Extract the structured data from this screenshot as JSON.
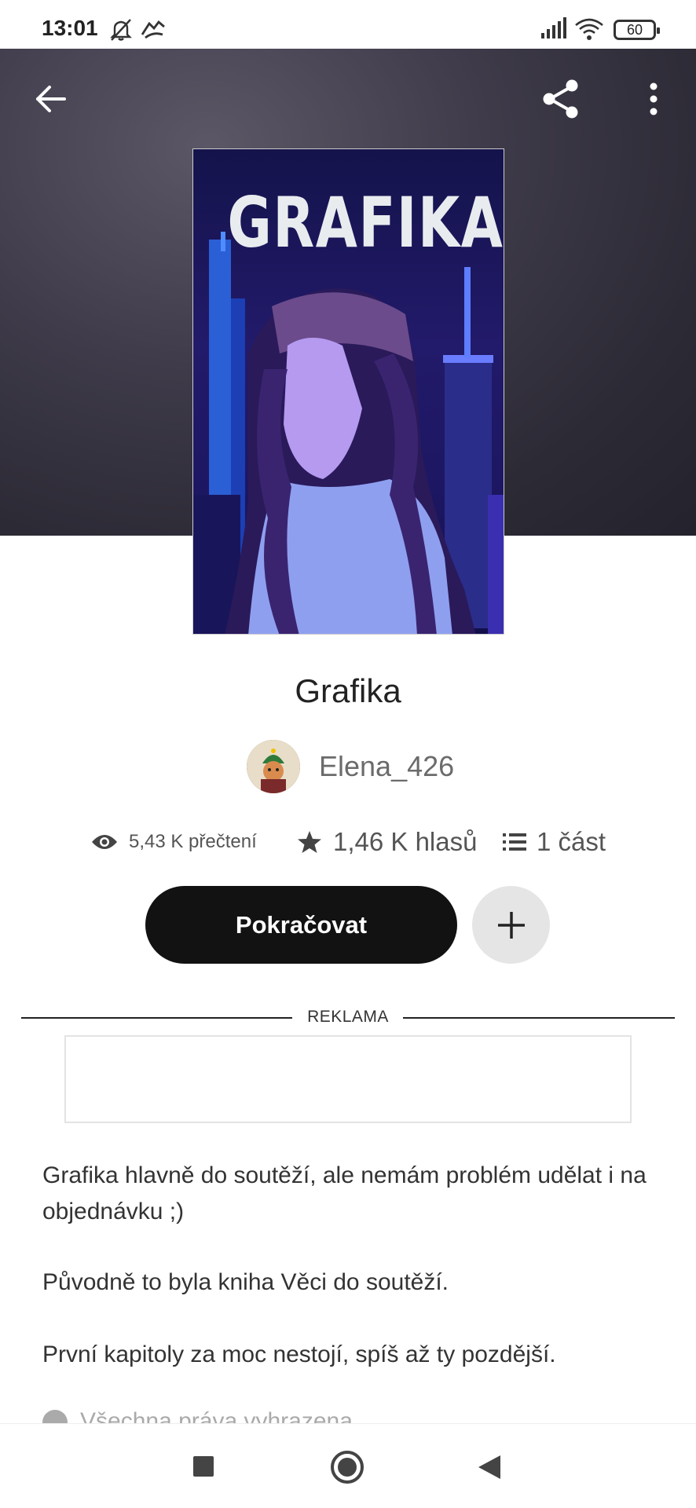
{
  "status_bar": {
    "time": "13:01",
    "battery": "60",
    "icons": [
      "bell-off-icon",
      "data-saver-icon",
      "signal-icon",
      "wifi-icon",
      "battery-icon"
    ]
  },
  "header": {
    "back_icon": "arrow-left-icon",
    "share_icon": "share-icon",
    "more_icon": "more-vertical-icon"
  },
  "cover": {
    "title_text": "GRAFIKA"
  },
  "book": {
    "title": "Grafika",
    "author": "Elena_426"
  },
  "stats": {
    "reads": "5,43 K přečtení",
    "votes": "1,46 K hlasů",
    "parts": "1 část"
  },
  "actions": {
    "continue_label": "Pokračovat",
    "add_icon": "plus-icon"
  },
  "ad": {
    "label": "REKLAMA"
  },
  "description": {
    "paragraphs": [
      "Grafika hlavně do soutěží, ale nemám problém udělat i na objednávku ;)",
      "Původně to byla kniha Věci do soutěží.",
      "První kapitoly za moc nestojí, spíš až ty pozdější."
    ],
    "rights": "Všechna práva vyhrazena"
  },
  "nav": {
    "icons": [
      "recents-icon",
      "home-icon",
      "back-icon"
    ]
  },
  "colors": {
    "button_dark": "#121212",
    "add_button_bg": "#e5e5e5",
    "header_bg": "#2c2a35"
  }
}
